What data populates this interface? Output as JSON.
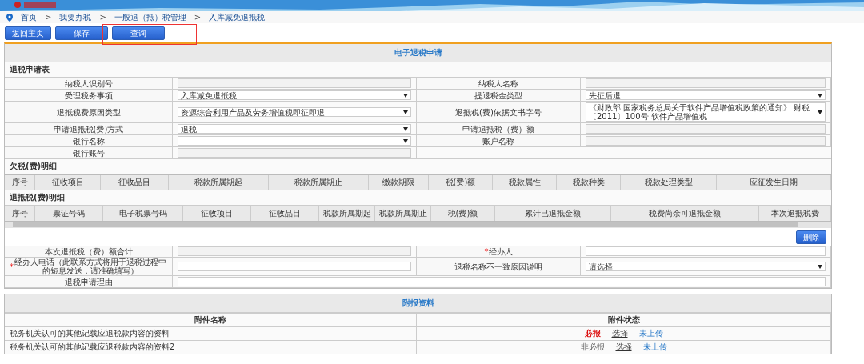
{
  "breadcrumb": {
    "separator": ">",
    "items": [
      "首页",
      "我要办税",
      "一般退（抵）税管理",
      "入库减免退抵税"
    ]
  },
  "toolbar": [
    {
      "label": "返回主页",
      "highlighted": false
    },
    {
      "label": "保存",
      "highlighted": false
    },
    {
      "label": "查询",
      "highlighted": true
    }
  ],
  "application": {
    "title": "电子退税申请",
    "section": "退税申请表",
    "rows": [
      {
        "kind": "half",
        "cells": [
          {
            "label": "纳税人识别号",
            "kind": "readonly"
          },
          {
            "label": "纳税人名称",
            "kind": "readonly"
          }
        ]
      },
      {
        "kind": "half",
        "cells": [
          {
            "label": "受理税务事项",
            "kind": "select",
            "value": "入库减免退抵税"
          },
          {
            "label": "提退税金类型",
            "kind": "select",
            "value": "先征后退"
          }
        ]
      },
      {
        "kind": "half",
        "cells": [
          {
            "label": "退抵税费原因类型",
            "kind": "select",
            "value": "资源综合利用产品及劳务增值税即征即退"
          },
          {
            "label": "退抵税(费)依据文书字号",
            "kind": "select",
            "value": "《财政部 国家税务总局关于软件产品增值税政策的通知》 财税〔2011〕100号 软件产品增值税"
          }
        ]
      },
      {
        "kind": "half",
        "cells": [
          {
            "label": "申请退抵税(费)方式",
            "kind": "select",
            "value": "退税"
          },
          {
            "label": "申请退抵税（费）额",
            "kind": "readonly"
          }
        ]
      },
      {
        "kind": "half",
        "cells": [
          {
            "label": "银行名称",
            "kind": "select"
          },
          {
            "label": "账户名称",
            "kind": "readonly"
          }
        ]
      },
      {
        "kind": "half",
        "cells": [
          {
            "label": "银行账号",
            "kind": "readonly"
          }
        ]
      }
    ]
  },
  "arrears": {
    "title": "欠税(费)明细",
    "columns": [
      "序号",
      "征收项目",
      "征收品目",
      "税款所属期起",
      "税款所属期止",
      "缴款期限",
      "税(费)额",
      "税款属性",
      "税款种类",
      "税款处理类型",
      "应征发生日期"
    ]
  },
  "refunds": {
    "title": "退抵税(费)明细",
    "columns": [
      "序号",
      "票证号码",
      "电子税票号码",
      "征收项目",
      "征收品目",
      "税款所属期起",
      "税款所属期止",
      "税(费)额",
      "累计已退抵金额",
      "税费尚余可退抵金额",
      "本次退抵税费"
    ]
  },
  "delete_button": "删除",
  "summary": {
    "rows": [
      {
        "kind": "half",
        "cells": [
          {
            "label": "本次退抵税（费）额合计",
            "kind": "readonly"
          },
          {
            "label": "经办人",
            "mark": "*",
            "kind": "input"
          }
        ]
      },
      {
        "kind": "half",
        "cells": [
          {
            "label": "经办人电话（此联系方式将用于退税过程中的短息发送，请准确填写）",
            "mark": "*",
            "kind": "input"
          },
          {
            "label": "退税名称不一致原因说明",
            "kind": "select",
            "value": "请选择"
          }
        ]
      },
      {
        "kind": "full",
        "cells": [
          {
            "label": "退税申请理由",
            "kind": "input"
          }
        ]
      }
    ]
  },
  "attachments": {
    "title": "附报资料",
    "columns": [
      "附件名称",
      "附件状态"
    ],
    "rows": [
      {
        "name": "税务机关认可的其他记载应退税款内容的资料",
        "requirement": "必报",
        "required": true,
        "action": "选择",
        "status": "未上传"
      },
      {
        "name": "税务机关认可的其他记载应退税款内容的资料2",
        "requirement": "非必报",
        "required": false,
        "action": "选择",
        "status": "未上传"
      }
    ]
  }
}
